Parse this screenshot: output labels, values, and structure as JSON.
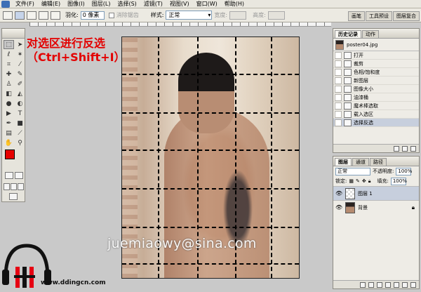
{
  "menubar": {
    "items": [
      "文件(F)",
      "编辑(E)",
      "图像(I)",
      "图层(L)",
      "选择(S)",
      "滤镜(T)",
      "视图(V)",
      "窗口(W)",
      "帮助(H)"
    ]
  },
  "options": {
    "feather_label": "羽化:",
    "feather_value": "0 像素",
    "antialias_label": "消除锯齿",
    "style_label": "样式:",
    "style_value": "正常",
    "width_label": "宽度:",
    "height_label": "高度:"
  },
  "palette_well": [
    "画笔",
    "工具预设",
    "图层复合"
  ],
  "callout": "对选区进行反选（Ctrl+Shift+I）",
  "watermark": "juemiaowy@sina.com",
  "logo": {
    "site": "www.ddingcn.com",
    "colors": {
      "red": "#e60012",
      "black": "#111111"
    }
  },
  "history_panel": {
    "tabs": [
      "历史记录",
      "动作"
    ],
    "snapshot": "poster04.jpg",
    "items": [
      "打开",
      "裁剪",
      "色相/饱和度",
      "新图层",
      "图像大小",
      "油漆桶",
      "魔术棒选取",
      "载入选区",
      "选择反选"
    ],
    "selected_index": 8
  },
  "layers_panel": {
    "tabs": [
      "图层",
      "通道",
      "路径"
    ],
    "blend_mode": "正常",
    "opacity_label": "不透明度:",
    "opacity_value": "100%",
    "lock_label": "锁定:",
    "fill_label": "填充:",
    "fill_value": "100%",
    "layers": [
      {
        "name": "图层 1",
        "selected": true
      },
      {
        "name": "背景",
        "selected": false
      }
    ]
  },
  "colors": {
    "foreground": "#e60000",
    "background": "#ffffff",
    "callout": "#e30000",
    "selected_row": "#c7cfdd"
  }
}
